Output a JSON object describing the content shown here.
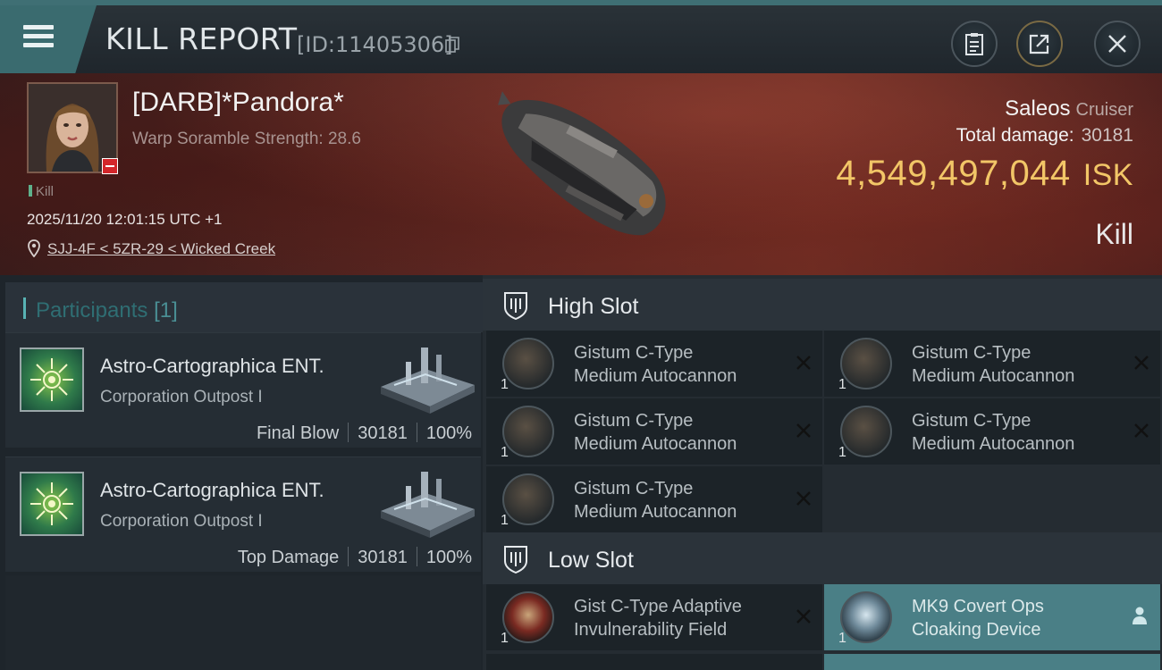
{
  "header": {
    "title": "KILL REPORT",
    "report_id": "[ID:11405306]",
    "buttons": [
      "clipboard-icon",
      "share-icon",
      "close-icon"
    ]
  },
  "victim": {
    "name": "[DARB]*Pandora*",
    "scramble": "Warp Soramble Strength: 28.6",
    "tag": "Kill",
    "datetime": "2025/11/20 12:01:15 UTC +1",
    "location": "SJJ-4F < 5ZR-29 < Wicked Creek",
    "ship_name": "Saleos",
    "ship_class": "Cruiser",
    "damage_label": "Total damage:",
    "damage_value": "30181",
    "isk_value": "4,549,497,044",
    "isk_unit": "ISK",
    "result": "Kill"
  },
  "participants": {
    "label": "Participants",
    "count": "[1]",
    "cards": [
      {
        "name": "Astro-Cartographica ENT.",
        "type": "Corporation Outpost I",
        "role": "Final Blow",
        "damage": "30181",
        "percent": "100%"
      },
      {
        "name": "Astro-Cartographica ENT.",
        "type": "Corporation Outpost I",
        "role": "Top Damage",
        "damage": "30181",
        "percent": "100%"
      }
    ]
  },
  "fittings": {
    "high_label": "High Slot",
    "low_label": "Low Slot",
    "high": [
      {
        "qty": "1",
        "line1": "Gistum C-Type",
        "line2": "Medium Autocannon"
      },
      {
        "qty": "1",
        "line1": "Gistum C-Type",
        "line2": "Medium Autocannon"
      },
      {
        "qty": "1",
        "line1": "Gistum C-Type",
        "line2": "Medium Autocannon"
      },
      {
        "qty": "1",
        "line1": "Gistum C-Type",
        "line2": "Medium Autocannon"
      },
      {
        "qty": "1",
        "line1": "Gistum C-Type",
        "line2": "Medium Autocannon"
      }
    ],
    "low": [
      {
        "qty": "1",
        "line1": "Gist C-Type Adaptive",
        "line2": "Invulnerability Field"
      },
      {
        "qty": "1",
        "line1": "MK9 Covert Ops",
        "line2": "Cloaking Device"
      }
    ]
  },
  "colors": {
    "accent": "#3f6f74",
    "isk": "#f2c667",
    "highlight": "#4a7f86",
    "banner": "#5a2621"
  }
}
